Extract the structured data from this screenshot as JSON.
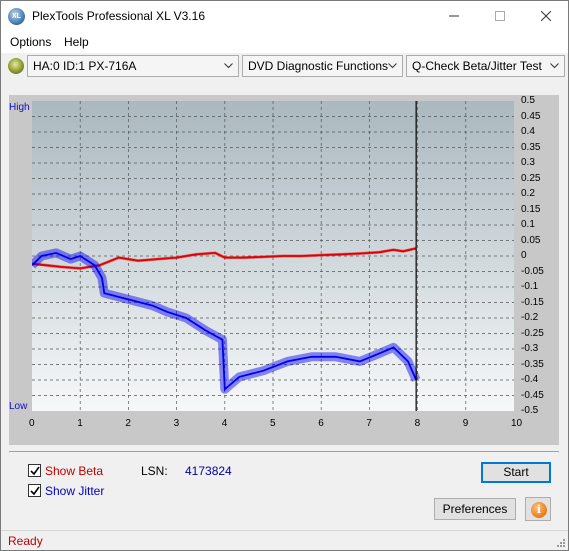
{
  "window": {
    "title": "PlexTools Professional XL V3.16",
    "app_icon_text": "XL"
  },
  "menu": {
    "options": "Options",
    "help": "Help"
  },
  "toolbar": {
    "drive": "HA:0 ID:1  PX-716A",
    "function": "DVD Diagnostic Functions",
    "test": "Q-Check Beta/Jitter Test"
  },
  "plot": {
    "high_label": "High",
    "low_label": "Low",
    "x_ticks": [
      "0",
      "1",
      "2",
      "3",
      "4",
      "5",
      "6",
      "7",
      "8",
      "9",
      "10"
    ],
    "y_ticks": [
      "0.5",
      "0.45",
      "0.4",
      "0.35",
      "0.3",
      "0.25",
      "0.2",
      "0.15",
      "0.1",
      "0.05",
      "0",
      "-0.05",
      "-0.1",
      "-0.15",
      "-0.2",
      "-0.25",
      "-0.3",
      "-0.35",
      "-0.4",
      "-0.45",
      "-0.5"
    ]
  },
  "controls": {
    "show_beta": "Show Beta",
    "show_jitter": "Show Jitter",
    "show_beta_checked": true,
    "show_jitter_checked": true,
    "lsn_label": "LSN:",
    "lsn_value": "4173824",
    "start": "Start",
    "preferences": "Preferences"
  },
  "status": {
    "text": "Ready"
  },
  "colors": {
    "beta": "#e00000",
    "jitter": "#0000ee",
    "accent": "#0078d7"
  },
  "chart_data": {
    "type": "line",
    "x_range": [
      0,
      10
    ],
    "y_range": [
      -0.5,
      0.5
    ],
    "grid": true,
    "cursor_x": 7.97,
    "series": [
      {
        "name": "Beta",
        "color": "#e00000",
        "x": [
          0,
          0.3,
          0.6,
          1.0,
          1.4,
          1.8,
          2.2,
          2.6,
          3.0,
          3.4,
          3.8,
          4.0,
          4.4,
          4.8,
          5.2,
          5.6,
          6.0,
          6.4,
          6.8,
          7.2,
          7.5,
          7.7,
          7.97
        ],
        "y": [
          -0.025,
          -0.03,
          -0.035,
          -0.04,
          -0.03,
          -0.005,
          -0.015,
          -0.01,
          -0.005,
          0.005,
          0.01,
          -0.005,
          -0.005,
          -0.003,
          0.0,
          0.0,
          0.003,
          0.005,
          0.008,
          0.012,
          0.02,
          0.015,
          0.025
        ]
      },
      {
        "name": "Jitter",
        "color": "#0000ee",
        "x": [
          0,
          0.2,
          0.5,
          0.8,
          1.0,
          1.3,
          1.45,
          1.5,
          2.0,
          2.5,
          2.8,
          3.2,
          3.6,
          3.95,
          4.0,
          4.3,
          4.8,
          5.3,
          5.8,
          6.3,
          6.8,
          7.2,
          7.5,
          7.8,
          7.97
        ],
        "y": [
          -0.03,
          0.0,
          0.01,
          -0.01,
          0.0,
          -0.03,
          -0.07,
          -0.12,
          -0.14,
          -0.16,
          -0.18,
          -0.2,
          -0.24,
          -0.27,
          -0.43,
          -0.39,
          -0.37,
          -0.34,
          -0.325,
          -0.325,
          -0.34,
          -0.315,
          -0.295,
          -0.34,
          -0.4
        ]
      }
    ]
  }
}
